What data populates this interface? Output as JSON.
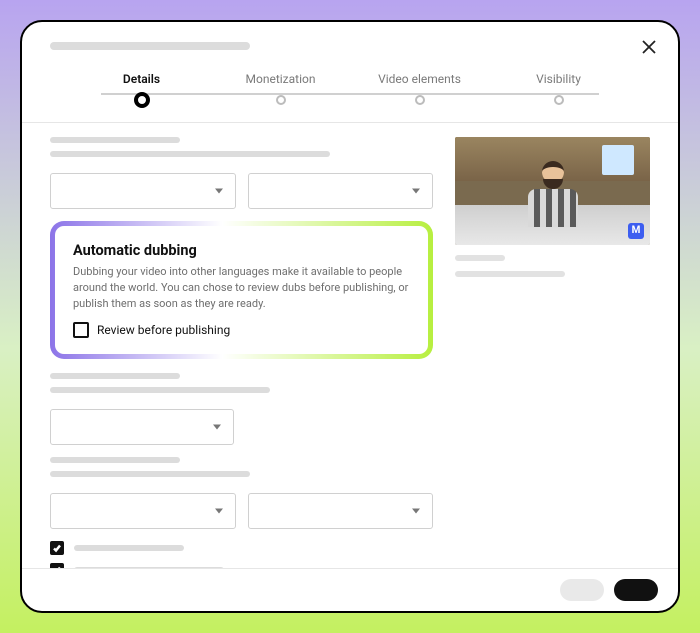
{
  "stepper": {
    "steps": [
      "Details",
      "Monetization",
      "Video elements",
      "Visibility"
    ],
    "active_index": 0
  },
  "highlight": {
    "title": "Automatic dubbing",
    "description": "Dubbing your video into other languages make it available to people around the world. You can chose to review dubs before publishing, or publish them as soon as they are ready.",
    "checkbox_label": "Review before publishing",
    "checkbox_checked": false
  },
  "thumbnail": {
    "badge_letter": "M"
  },
  "bottom_checks": [
    {
      "checked": true
    },
    {
      "checked": true
    }
  ],
  "footer": {
    "secondary_label": "",
    "primary_label": ""
  }
}
